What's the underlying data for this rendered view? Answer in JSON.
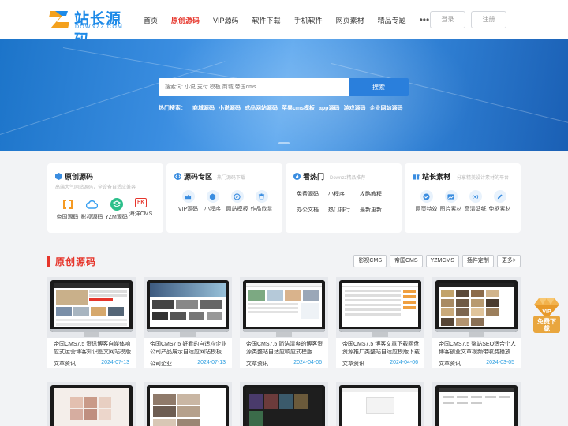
{
  "header": {
    "logo_title": "站长源码",
    "logo_sub": "DOWNZZ.COM",
    "nav": [
      "首页",
      "原创源码",
      "VIP源码",
      "软件下载",
      "手机软件",
      "网页素材",
      "精品专题"
    ],
    "nav_active_index": 1,
    "nav_more": "•••",
    "login": "登录",
    "register": "注册"
  },
  "banner": {
    "search_placeholder": "搜索词: 小说 支付 模板 商城 帝国cms",
    "search_button": "搜索",
    "hot_label": "热门搜索：",
    "hot_items": [
      "商城源码",
      "小说源码",
      "成品网站源码",
      "苹果cms模板",
      "app源码",
      "游戏源码",
      "企业网站源码"
    ]
  },
  "cards": [
    {
      "title": "原创源码",
      "desc": "高端大气网站源码，全设备自适应兼容",
      "icon": "box-icon",
      "items": [
        {
          "label": "帝国源码",
          "icon": "bracket-icon",
          "color": "#f59a23"
        },
        {
          "label": "影视源码",
          "icon": "cloud-icon",
          "color": "#3aa0f0"
        },
        {
          "label": "YZM源码",
          "icon": "stack-icon",
          "color": "#2bbf8a"
        },
        {
          "label": "海洋CMS",
          "icon": "hk-icon",
          "color": "#e6352b"
        }
      ]
    },
    {
      "title": "源码专区",
      "desc": "热门源码下载",
      "icon": "code-icon",
      "items": [
        {
          "label": "VIP源码",
          "icon": "crown-icon",
          "color": "#3a8de0"
        },
        {
          "label": "小程序",
          "icon": "hex-icon",
          "color": "#3a8de0"
        },
        {
          "label": "网站模板",
          "icon": "compass-icon",
          "color": "#3a8de0"
        },
        {
          "label": "作品欣赏",
          "icon": "bin-icon",
          "color": "#3a8de0"
        }
      ]
    },
    {
      "title": "看热门",
      "desc": "Downzz精品推荐",
      "icon": "fire-icon",
      "tags": [
        "免费源码",
        "小程序",
        "攻略教程",
        "办公文档",
        "热门排行",
        "最新更新"
      ]
    },
    {
      "title": "站长素材",
      "desc": "分享精美设计素材的平台",
      "icon": "gift-icon",
      "items": [
        {
          "label": "网页特效",
          "icon": "check-icon",
          "color": "#3a8de0"
        },
        {
          "label": "图片素材",
          "icon": "image-icon",
          "color": "#3a8de0"
        },
        {
          "label": "高清壁纸",
          "icon": "wave-icon",
          "color": "#3a8de0"
        },
        {
          "label": "免抠素材",
          "icon": "edit-icon",
          "color": "#3a8de0"
        }
      ]
    }
  ],
  "section": {
    "title": "原创源码",
    "tags": [
      "影视CMS",
      "帝国CMS",
      "YZMCMS",
      "插件定制",
      "更多>"
    ]
  },
  "items": [
    {
      "title": "帝国CMS7.5 资讯博客自媒体响应式运营博客知识图文网站模版",
      "cat": "文章资讯",
      "date": "2024-07-13"
    },
    {
      "title": "帝国CMS7.5 好看的自适应企业公司产品展示自适应网站模板",
      "cat": "公司企业",
      "date": "2024-07-13"
    },
    {
      "title": "帝国CMS7.5 简洁清爽的博客资源类整站自适应响应式模版",
      "cat": "文章资讯",
      "date": "2024-04-06"
    },
    {
      "title": "帝国CMS7.5 博客文章下载网盘资源推广类整站自适应模版下载",
      "cat": "文章资讯",
      "date": "2024-04-06"
    },
    {
      "title": "帝国CMS7.5 整站SEO适合个人博客创业文章视频带收费播放",
      "cat": "文章资讯",
      "date": "2024-03-05"
    }
  ],
  "vip_badge": {
    "top": "VIP",
    "bottom": "免费下载"
  },
  "colors": {
    "accent": "#e6352b",
    "brand": "#1d8ae8",
    "date": "#2a9de0"
  }
}
